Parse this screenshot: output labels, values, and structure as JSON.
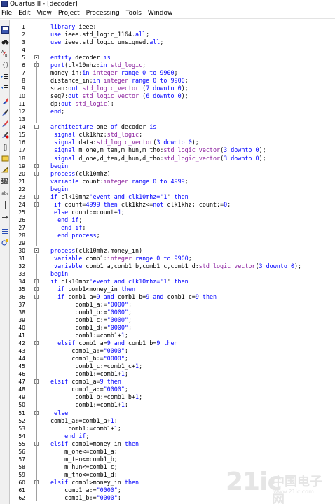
{
  "window": {
    "title": "Quartus II - [decoder]"
  },
  "menu": [
    "File",
    "Edit",
    "View",
    "Project",
    "Processing",
    "Tools",
    "Window"
  ],
  "toolbar": {
    "icons": [
      "editor-icon",
      "find-icon",
      "find-replace-icon",
      "bracket-icon",
      "indent-icon",
      "unindent-icon",
      "brush-icon",
      "pen-icon",
      "highlight-icon",
      "stop-icon",
      "clip-icon",
      "template-icon",
      "insert-icon",
      "line-number-icon",
      "ab-icon",
      "vertical-bar-icon",
      "arrow-icon",
      "list-icon",
      "settings-icon"
    ],
    "line_number_label": [
      "267",
      "268"
    ],
    "ab_label": "ab/"
  },
  "watermark": {
    "brand": "21ic",
    "brand_cn": "中国电子网",
    "url": "www.21ic.com"
  },
  "code_lines": [
    {
      "n": "1",
      "t": "library ieee;"
    },
    {
      "n": "2",
      "t": "use ieee.std_logic_1164.all;"
    },
    {
      "n": "3",
      "t": "use ieee.std_logic_unsigned.all;"
    },
    {
      "n": "4",
      "t": ""
    },
    {
      "n": "5",
      "t": "entity decoder is",
      "fold": true
    },
    {
      "n": "6",
      "t": "port(clk10mhz:in std_logic;",
      "fold": true
    },
    {
      "n": "7",
      "t": "money_in:in integer range 0 to 9900;"
    },
    {
      "n": "8",
      "t": "distance_in:in integer range 0 to 9900;"
    },
    {
      "n": "9",
      "t": "scan:out std_logic_vector (7 downto 0);"
    },
    {
      "n": "10",
      "t": "seg7:out std_logic_vector (6 downto 0);"
    },
    {
      "n": "11",
      "t": "dp:out std_logic);"
    },
    {
      "n": "12",
      "t": "end;"
    },
    {
      "n": "13",
      "t": ""
    },
    {
      "n": "14",
      "t": "architecture one of decoder is",
      "fold": true
    },
    {
      "n": "15",
      "t": " signal clk1khz:std_logic;"
    },
    {
      "n": "16",
      "t": " signal data:std_logic_vector(3 downto 0);"
    },
    {
      "n": "17",
      "t": " signal m_one,m_ten,m_hun,m_tho:std_logic_vector(3 downto 0);"
    },
    {
      "n": "18",
      "t": " signal d_one,d_ten,d_hun,d_tho:std_logic_vector(3 downto 0);"
    },
    {
      "n": "19",
      "t": "begin",
      "fold": true
    },
    {
      "n": "20",
      "t": "process(clk10mhz)",
      "fold": true
    },
    {
      "n": "21",
      "t": "variable count:integer range 0 to 4999;"
    },
    {
      "n": "22",
      "t": "begin"
    },
    {
      "n": "23",
      "t": "if clk10mhz'event and clk10mhz='1' then",
      "fold": true
    },
    {
      "n": "24",
      "t": " if count=4999 then clk1khz<=not clk1khz; count:=0;",
      "fold": true
    },
    {
      "n": "25",
      "t": " else count:=count+1;"
    },
    {
      "n": "26",
      "t": "  end if;"
    },
    {
      "n": "27",
      "t": "   end if;"
    },
    {
      "n": "28",
      "t": "  end process;"
    },
    {
      "n": "29",
      "t": ""
    },
    {
      "n": "30",
      "t": "process(clk10mhz,money_in)",
      "fold": true
    },
    {
      "n": "31",
      "t": " variable comb1:integer range 0 to 9900;"
    },
    {
      "n": "32",
      "t": " variable comb1_a,comb1_b,comb1_c,comb1_d:std_logic_vector(3 downto 0);"
    },
    {
      "n": "33",
      "t": "begin"
    },
    {
      "n": "34",
      "t": "if clk10mhz'event and clk10mhz='1' then",
      "fold": true
    },
    {
      "n": "35",
      "t": "  if comb1<money_in then",
      "fold": true
    },
    {
      "n": "36",
      "t": "  if comb1_a=9 and comb1_b=9 and comb1_c=9 then",
      "fold": true
    },
    {
      "n": "37",
      "t": "       comb1_a:=\"0000\";"
    },
    {
      "n": "38",
      "t": "       comb1_b:=\"0000\";"
    },
    {
      "n": "39",
      "t": "       comb1_c:=\"0000\";"
    },
    {
      "n": "40",
      "t": "       comb1_d:=\"0000\";"
    },
    {
      "n": "41",
      "t": "       comb1:=comb1+1;"
    },
    {
      "n": "42",
      "t": "  elsif comb1_a=9 and comb1_b=9 then",
      "fold": true
    },
    {
      "n": "43",
      "t": "      comb1_a:=\"0000\";"
    },
    {
      "n": "44",
      "t": "      comb1_b:=\"0000\";"
    },
    {
      "n": "45",
      "t": "       comb1_c:=comb1_c+1;"
    },
    {
      "n": "46",
      "t": "       comb1:=comb1+1;"
    },
    {
      "n": "47",
      "t": "elsif comb1_a=9 then",
      "fold": true
    },
    {
      "n": "48",
      "t": "      comb1_a:=\"0000\";"
    },
    {
      "n": "49",
      "t": "       comb1_b:=comb1_b+1;"
    },
    {
      "n": "50",
      "t": "       comb1:=comb1+1;"
    },
    {
      "n": "51",
      "t": " else",
      "fold": true
    },
    {
      "n": "52",
      "t": "comb1_a:=comb1_a+1;"
    },
    {
      "n": "53",
      "t": "     comb1:=comb1+1;"
    },
    {
      "n": "54",
      "t": "    end if;"
    },
    {
      "n": "55",
      "t": "elsif comb1=money_in then",
      "fold": true
    },
    {
      "n": "56",
      "t": "    m_one<=comb1_a;"
    },
    {
      "n": "57",
      "t": "    m_ten<=comb1_b;"
    },
    {
      "n": "58",
      "t": "    m_hun<=comb1_c;"
    },
    {
      "n": "59",
      "t": "    m_tho<=comb1_d;"
    },
    {
      "n": "60",
      "t": "elsif comb1>money_in then",
      "fold": true
    },
    {
      "n": "61",
      "t": "    comb1_a:=\"0000\";"
    },
    {
      "n": "62",
      "t": "    comb1_b:=\"0000\";"
    }
  ]
}
